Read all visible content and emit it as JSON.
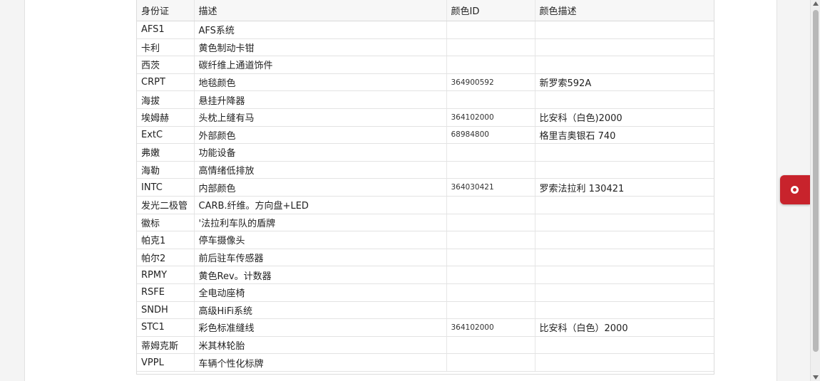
{
  "table": {
    "headers": {
      "id": "身份证",
      "desc": "描述",
      "color_id": "颜色ID",
      "color_desc": "颜色描述"
    },
    "rows": [
      {
        "id": "AFS1",
        "desc": "AFS系统",
        "color_id": "",
        "color_desc": ""
      },
      {
        "id": "卡利",
        "desc": "黄色制动卡钳",
        "color_id": "",
        "color_desc": ""
      },
      {
        "id": "西茨",
        "desc": "碳纤维上通道饰件",
        "color_id": "",
        "color_desc": ""
      },
      {
        "id": "CRPT",
        "desc": "地毯颜色",
        "color_id": "364900592",
        "color_desc": "新罗索592A"
      },
      {
        "id": "海拔",
        "desc": "悬挂升降器",
        "color_id": "",
        "color_desc": ""
      },
      {
        "id": "埃姆赫",
        "desc": "头枕上缝有马",
        "color_id": "364102000",
        "color_desc": "比安科（白色)2000"
      },
      {
        "id": "ExtC",
        "desc": "外部颜色",
        "color_id": "68984800",
        "color_desc": "格里吉奥银石 740"
      },
      {
        "id": "弗嫩",
        "desc": "功能设备",
        "color_id": "",
        "color_desc": ""
      },
      {
        "id": "海勒",
        "desc": "高情绪低排放",
        "color_id": "",
        "color_desc": ""
      },
      {
        "id": "INTC",
        "desc": "内部颜色",
        "color_id": "364030421",
        "color_desc": "罗索法拉利 130421"
      },
      {
        "id": "发光二极管",
        "desc": "CARB.纤维。方向盘+LED",
        "color_id": "",
        "color_desc": ""
      },
      {
        "id": "徽标",
        "desc": "'法拉利车队的盾牌",
        "color_id": "",
        "color_desc": ""
      },
      {
        "id": "帕克1",
        "desc": "停车摄像头",
        "color_id": "",
        "color_desc": ""
      },
      {
        "id": "帕尔2",
        "desc": "前后驻车传感器",
        "color_id": "",
        "color_desc": ""
      },
      {
        "id": "RPMY",
        "desc": "黄色Rev。计数器",
        "color_id": "",
        "color_desc": ""
      },
      {
        "id": "RSFE",
        "desc": "全电动座椅",
        "color_id": "",
        "color_desc": ""
      },
      {
        "id": "SNDH",
        "desc": "高级HiFi系统",
        "color_id": "",
        "color_desc": ""
      },
      {
        "id": "STC1",
        "desc": "彩色标准缝线",
        "color_id": "364102000",
        "color_desc": "比安科（白色）2000"
      },
      {
        "id": "蒂姆克斯",
        "desc": "米其林轮胎",
        "color_id": "",
        "color_desc": ""
      },
      {
        "id": "VPPL",
        "desc": "车辆个性化标牌",
        "color_id": "",
        "color_desc": ""
      }
    ]
  },
  "floating_button": {
    "icon": "record-icon",
    "color": "#c8232c"
  },
  "colors": {
    "accent": "#c8232c",
    "border": "#dcdcdc"
  }
}
